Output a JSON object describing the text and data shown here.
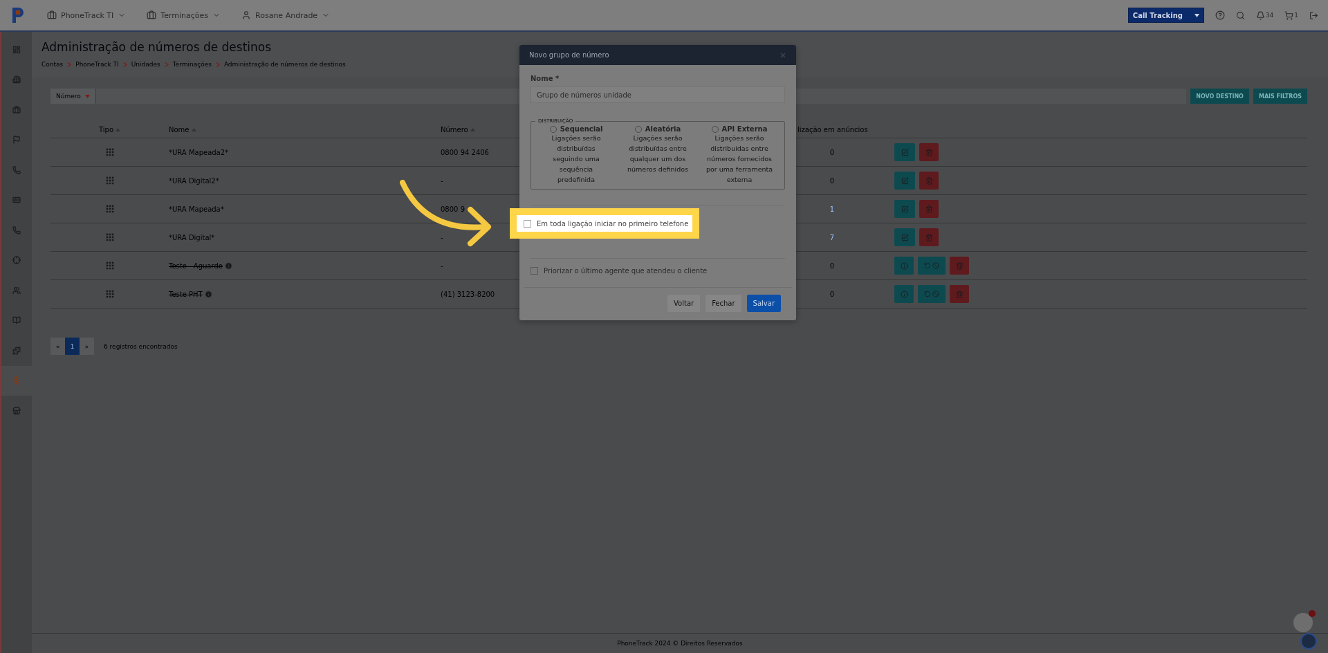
{
  "topbar": {
    "menus": [
      {
        "label": "PhoneTrack TI"
      },
      {
        "label": "Terminações"
      },
      {
        "label": "Rosane Andrade"
      }
    ],
    "product_select": "Call Tracking",
    "notifications": "34",
    "cart": "1"
  },
  "sidebar": {
    "items": [
      {
        "selected": false
      },
      {
        "selected": false
      },
      {
        "selected": false
      },
      {
        "selected": false
      },
      {
        "selected": false
      },
      {
        "selected": false
      },
      {
        "selected": false
      },
      {
        "selected": false
      },
      {
        "selected": false
      },
      {
        "selected": false
      },
      {
        "selected": false
      },
      {
        "selected": true
      },
      {
        "selected": false
      }
    ]
  },
  "page": {
    "title": "Administração de números de destinos",
    "breadcrumbs": [
      "Contas",
      "PhoneTrack TI",
      "Unidades",
      "Terminações",
      "Administração de números de destinos"
    ]
  },
  "filter": {
    "label": "Número",
    "buttons": [
      "NOVO DESTINO",
      "MAIS FILTROS"
    ]
  },
  "table": {
    "columns": [
      "Tipo",
      "Nome",
      "Número",
      "lização em anúncios"
    ],
    "rows": [
      {
        "name": "*URA Mapeada2*",
        "deleted": false,
        "number": "0800 94 2406",
        "usage": "0",
        "link": false
      },
      {
        "name": "*URA Digital2*",
        "deleted": false,
        "number": "-",
        "usage": "0",
        "link": false
      },
      {
        "name": "*URA Mapeada*",
        "deleted": false,
        "number": "0800 9",
        "usage": "1",
        "link": true
      },
      {
        "name": "*URA Digital*",
        "deleted": false,
        "number": "-",
        "usage": "7",
        "link": true
      },
      {
        "name": "Teste - Aguarde",
        "deleted": true,
        "number": "-",
        "usage": "0",
        "link": false
      },
      {
        "name": "Teste PHT",
        "deleted": true,
        "number": "(41) 3123-8200",
        "usage": "0",
        "link": false
      }
    ]
  },
  "pagination": {
    "prev": "«",
    "pages": [
      {
        "label": "1",
        "selected": true
      }
    ],
    "next": "»",
    "count": "6 registros encontrados"
  },
  "modal": {
    "title": "Novo grupo de número",
    "name_label": "Nome *",
    "name_value": "Grupo de números unidade",
    "legend": "DISTRIBUIÇÃO",
    "options": [
      {
        "title": "Sequencial",
        "description": "Ligações serão distribuídas seguindo uma sequência predefinida",
        "selected": false
      },
      {
        "title": "Aleatória",
        "description": "Ligações serão distribuídas entre qualquer um dos números definidos",
        "selected": false
      },
      {
        "title": "API Externa",
        "description": "Ligações serão distribuídas entre números fornecidos por uma ferramenta externa",
        "selected": false
      }
    ],
    "highlighted_checkbox": {
      "label": "Em toda ligação iniciar no primeiro telefone",
      "checked": false
    },
    "checkbox": {
      "label": "Priorizar o último agente que atendeu o cliente",
      "checked": false
    },
    "buttons": [
      {
        "label": "Voltar",
        "kind": "secondary"
      },
      {
        "label": "Fechar",
        "kind": "secondary"
      },
      {
        "label": "Salvar",
        "kind": "primary"
      }
    ]
  },
  "footer": "PhoneTrack 2024 © Direitos Reservados"
}
